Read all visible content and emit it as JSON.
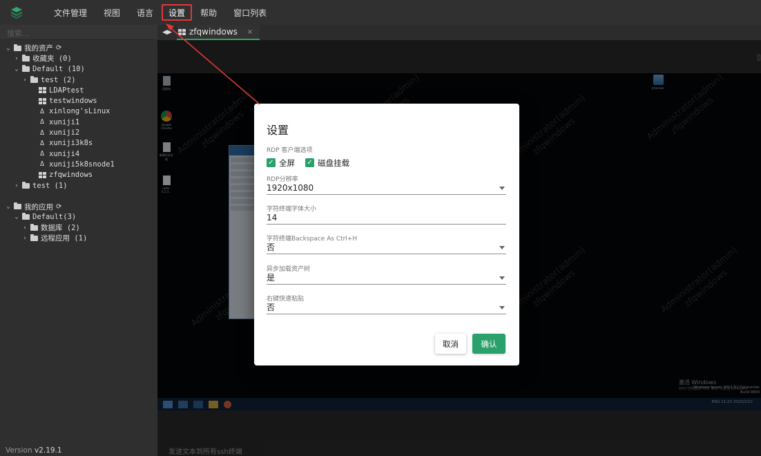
{
  "menu": {
    "items": [
      "文件管理",
      "视图",
      "语言",
      "设置",
      "帮助",
      "窗口列表"
    ],
    "active_index": 3
  },
  "search": {
    "placeholder": "搜索..."
  },
  "tree": {
    "rows": [
      {
        "label": "我的资产",
        "chev": "v",
        "icon": "folder-open",
        "indent": 0,
        "refresh": true
      },
      {
        "label": "收藏夹 (0)",
        "chev": ">",
        "icon": "folder",
        "indent": 1
      },
      {
        "label": "Default (10)",
        "chev": "v",
        "icon": "folder-open",
        "indent": 1
      },
      {
        "label": "test (2)",
        "chev": ">",
        "icon": "folder",
        "indent": 2
      },
      {
        "label": "LDAPtest",
        "chev": "",
        "icon": "windows",
        "indent": 3
      },
      {
        "label": "testwindows",
        "chev": "",
        "icon": "windows",
        "indent": 3
      },
      {
        "label": "xinlong'sLinux",
        "chev": "",
        "icon": "linux",
        "indent": 3
      },
      {
        "label": "xuniji1",
        "chev": "",
        "icon": "linux",
        "indent": 3
      },
      {
        "label": "xuniji2",
        "chev": "",
        "icon": "linux",
        "indent": 3
      },
      {
        "label": "xuniji3k8s",
        "chev": "",
        "icon": "linux",
        "indent": 3
      },
      {
        "label": "xuniji4",
        "chev": "",
        "icon": "linux",
        "indent": 3
      },
      {
        "label": "xuniji5k8snode1",
        "chev": "",
        "icon": "linux",
        "indent": 3
      },
      {
        "label": "zfqwindows",
        "chev": "",
        "icon": "windows",
        "indent": 3
      },
      {
        "label": "test (1)",
        "chev": ">",
        "icon": "folder",
        "indent": 1
      },
      {
        "label": "",
        "chev": "",
        "icon": "",
        "indent": 0
      },
      {
        "label": "我的应用",
        "chev": "v",
        "icon": "folder-open",
        "indent": 0,
        "refresh": true
      },
      {
        "label": "Default(3)",
        "chev": "v",
        "icon": "folder-open",
        "indent": 1
      },
      {
        "label": "数据库 (2)",
        "chev": ">",
        "icon": "folder",
        "indent": 2
      },
      {
        "label": "远程应用 (1)",
        "chev": ">",
        "icon": "folder",
        "indent": 2
      }
    ]
  },
  "version": {
    "prefix": "Version",
    "number": "v2.19.1"
  },
  "tab": {
    "title": "zfqwindows",
    "close": "×",
    "arrows": "◀▶"
  },
  "remote": {
    "watermark": "Administrator(admin)\nzfqwindows",
    "icons": [
      {
        "name": "recycle-bin-icon",
        "label": "回收站"
      },
      {
        "name": "chrome-icon",
        "label": "Google Chrome"
      },
      {
        "name": "text-file-icon",
        "label": "新建文本文档"
      },
      {
        "name": "redis-file-icon",
        "label": "redis-4.2.3..."
      },
      {
        "name": "jmserver-icon",
        "label": "Jmserver"
      }
    ],
    "activate_title": "激活 Windows",
    "activate_sub": "转到\"控制面板\"中的\"系统\"以激活 Windows。",
    "edition": "Windows Server 2012 R2 Datacenter",
    "build": "Build 9600",
    "tray": "ENG  11:23  2023/2/22",
    "explorer_items": [
      "仪表板",
      "本地服务器",
      "所有服务器",
      "AD DS",
      "DNS",
      "IIS",
      "文件和存储服务",
      "远程桌面服务"
    ]
  },
  "modal": {
    "title": "设置",
    "rdp_options_label": "RDP 客户端选项",
    "checkbox_fullscreen": "全屏",
    "checkbox_disk": "磁盘挂载",
    "resolution_label": "RDP分辨率",
    "resolution_value": "1920x1080",
    "fontsize_label": "字符终端字体大小",
    "fontsize_value": "14",
    "backspace_label": "字符终端Backspace As Ctrl+H",
    "backspace_value": "否",
    "async_label": "异步加载资产树",
    "async_value": "是",
    "paste_label": "右键快速粘贴",
    "paste_value": "否",
    "cancel_label": "取消",
    "ok_label": "确认"
  },
  "bottom_hint": "发送文本到所有ssh终端",
  "colors": {
    "accent": "#2aa06a",
    "highlight": "#e33838",
    "taskbar": "#12233b"
  }
}
